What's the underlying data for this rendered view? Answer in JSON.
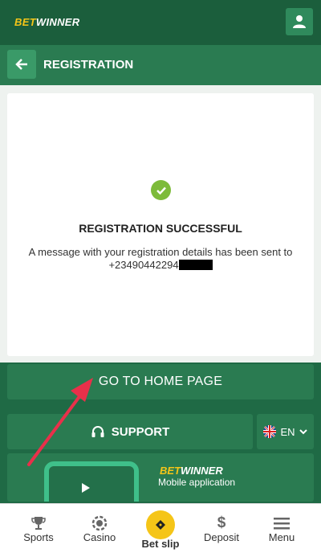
{
  "brand": {
    "bet": "BET",
    "winner": "WINNER"
  },
  "header": {
    "title": "REGISTRATION"
  },
  "card": {
    "title": "REGISTRATION SUCCESSFUL",
    "message": "A message with your registration details has been sent to",
    "phone": "+23490442294"
  },
  "buttons": {
    "home": "GO TO HOME PAGE",
    "support": "SUPPORT",
    "language": "EN"
  },
  "banner": {
    "bet": "BET",
    "winner": "WINNER",
    "subtitle": "Mobile application"
  },
  "nav": {
    "sports": "Sports",
    "casino": "Casino",
    "betslip": "Bet slip",
    "deposit": "Deposit",
    "menu": "Menu"
  },
  "colors": {
    "primary": "#2a7b51",
    "dark": "#1b5e3c",
    "accent": "#f5c518",
    "success": "#7dbb3a",
    "annotation": "#e8304a"
  },
  "icons": [
    "user-icon",
    "back-arrow-icon",
    "check-icon",
    "headset-icon",
    "uk-flag-icon",
    "chevron-down-icon",
    "play-store-icon",
    "trophy-icon",
    "casino-chip-icon",
    "ticket-icon",
    "dollar-icon",
    "hamburger-icon"
  ]
}
